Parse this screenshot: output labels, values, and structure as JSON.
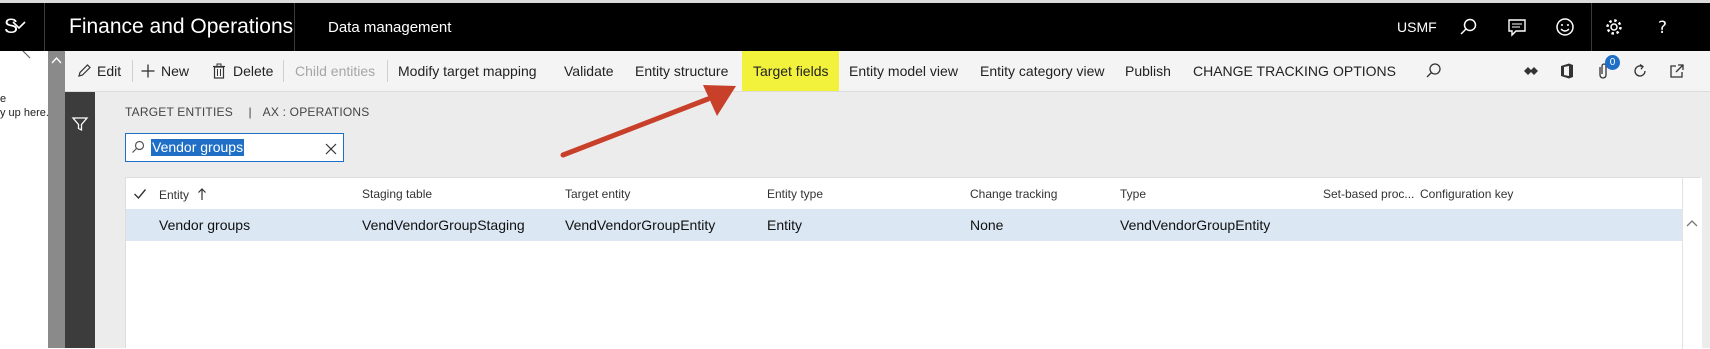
{
  "topbar": {
    "app_title": "Finance and Operations",
    "module": "Data management",
    "company": "USMF",
    "left_glyph": "S",
    "icons": [
      "chevron-down-icon",
      "search-icon",
      "message-icon",
      "smiley-icon",
      "gear-icon",
      "help-icon"
    ]
  },
  "left_panel": {
    "line1": "e",
    "line2": "y up here."
  },
  "actionbar": {
    "edit": "Edit",
    "new": "New",
    "delete": "Delete",
    "child_entities": "Child entities",
    "modify_target_mapping": "Modify target mapping",
    "validate": "Validate",
    "entity_structure": "Entity structure",
    "target_fields": "Target fields",
    "entity_model_view": "Entity model view",
    "entity_category_view": "Entity category view",
    "publish": "Publish",
    "change_tracking": "CHANGE TRACKING",
    "options": "OPTIONS",
    "badge_count": "0",
    "highlight_color": "#f2f23c"
  },
  "breadcrumb": {
    "part1": "TARGET ENTITIES",
    "separator": "|",
    "part2": "AX : OPERATIONS"
  },
  "search": {
    "value": "Vendor groups"
  },
  "grid": {
    "columns": [
      "Entity",
      "Staging table",
      "Target entity",
      "Entity type",
      "Change tracking",
      "Type",
      "Set-based proc...",
      "Configuration key"
    ],
    "rows": [
      {
        "entity": "Vendor groups",
        "staging_table": "VendVendorGroupStaging",
        "target_entity": "VendVendorGroupEntity",
        "entity_type": "Entity",
        "change_tracking": "None",
        "type": "VendVendorGroupEntity",
        "set_based": "",
        "configuration_key": ""
      }
    ]
  },
  "annotation": {
    "arrow_color": "#c8402a"
  }
}
